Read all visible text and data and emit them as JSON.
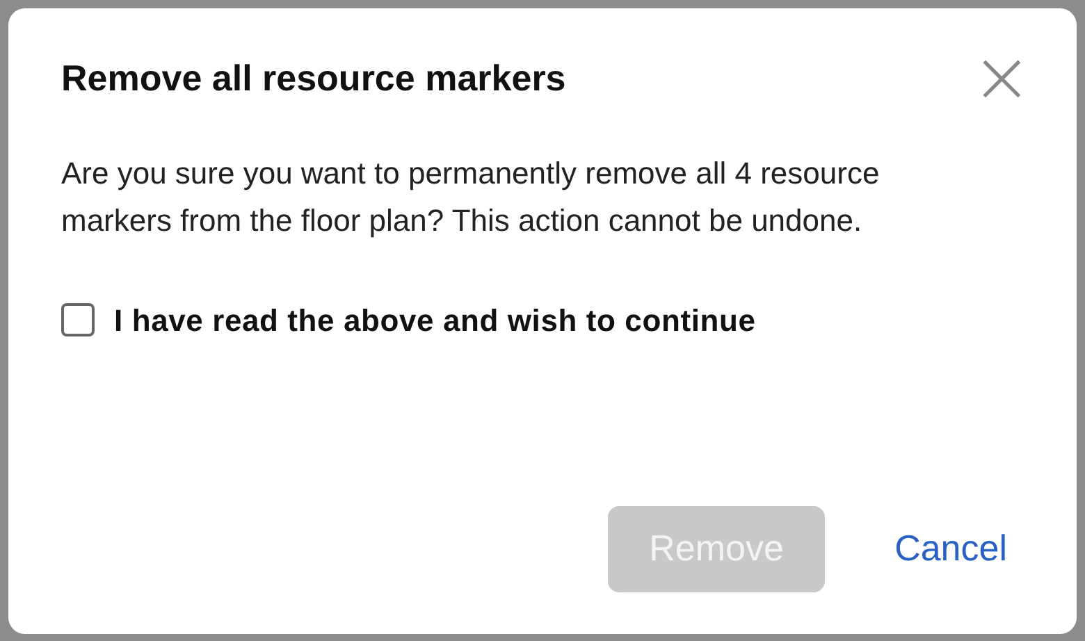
{
  "dialog": {
    "title": "Remove all resource markers",
    "close": "×",
    "message": "Are you sure you want to permanently remove all 4 resource markers from the floor plan? This action cannot be undone.",
    "checkbox": {
      "label": "I have read the above and wish to continue",
      "checked": false
    },
    "buttons": [
      {
        "label": "Remove",
        "kind": "primary",
        "disabled": true
      },
      {
        "label": "Cancel",
        "kind": "link",
        "disabled": false
      }
    ]
  }
}
